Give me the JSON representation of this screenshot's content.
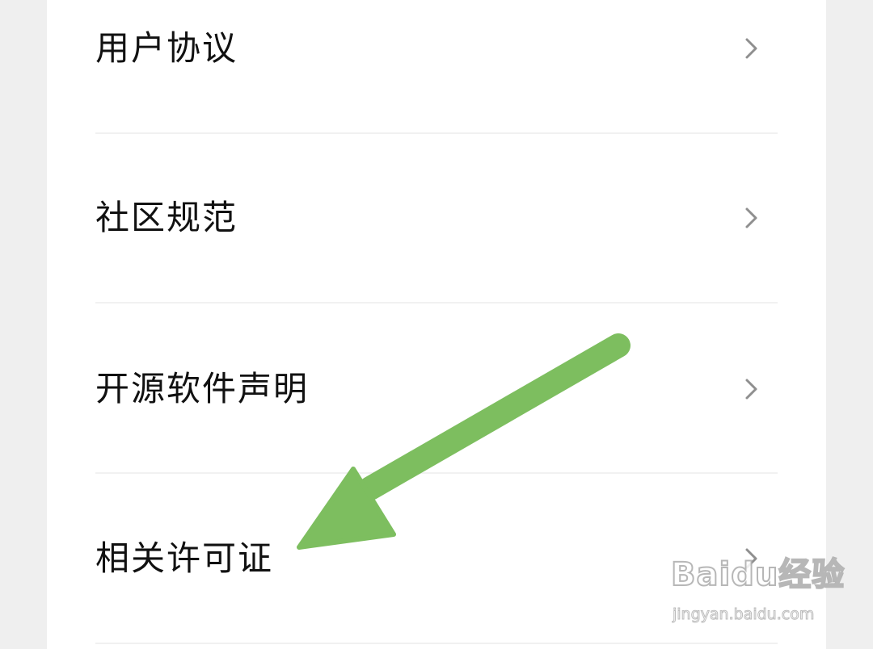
{
  "menu": {
    "items": [
      {
        "label": "用户协议",
        "icon": "chevron-right-icon"
      },
      {
        "label": "社区规范",
        "icon": "chevron-right-icon"
      },
      {
        "label": "开源软件声明",
        "icon": "chevron-right-icon"
      },
      {
        "label": "相关许可证",
        "icon": "chevron-right-icon"
      }
    ]
  },
  "annotation": {
    "arrow_color": "#7dbe5f",
    "icon": "annotation-arrow-icon"
  },
  "watermark": {
    "brand": "Baidu经验",
    "url": "jingyan.baidu.com"
  },
  "colors": {
    "background": "#efefef",
    "card": "#ffffff",
    "text": "#111111",
    "chevron": "#8f8f8f",
    "divider": "#f1f1f1"
  }
}
